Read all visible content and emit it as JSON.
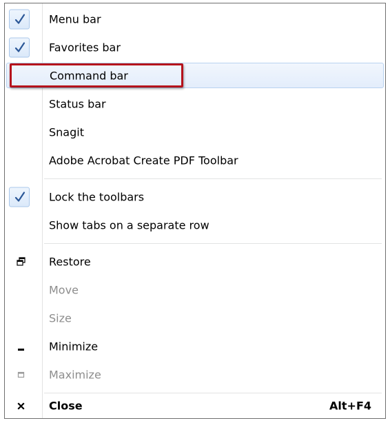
{
  "menu": {
    "items": [
      {
        "label": "Menu bar",
        "checked": true
      },
      {
        "label": "Favorites bar",
        "checked": true
      },
      {
        "label": "Command bar",
        "checked": false,
        "highlighted": true
      },
      {
        "label": "Status bar",
        "checked": false
      },
      {
        "label": "Snagit",
        "checked": false
      },
      {
        "label": "Adobe Acrobat Create PDF Toolbar",
        "checked": false
      },
      {
        "label": "Lock the toolbars",
        "checked": true
      },
      {
        "label": "Show tabs on a separate row",
        "checked": false
      },
      {
        "label": "Restore",
        "icon": "restore-icon"
      },
      {
        "label": "Move",
        "disabled": true
      },
      {
        "label": "Size",
        "disabled": true
      },
      {
        "label": "Minimize",
        "icon": "minimize-icon"
      },
      {
        "label": "Maximize",
        "icon": "maximize-icon",
        "disabled": true
      },
      {
        "label": "Close",
        "icon": "close-icon",
        "shortcut": "Alt+F4",
        "bold": true
      }
    ]
  },
  "colors": {
    "annotation_border": "#b5121b",
    "check_color": "#2b5797",
    "disabled_text": "#8d8d8d",
    "highlight_border": "#b8d2f0"
  }
}
